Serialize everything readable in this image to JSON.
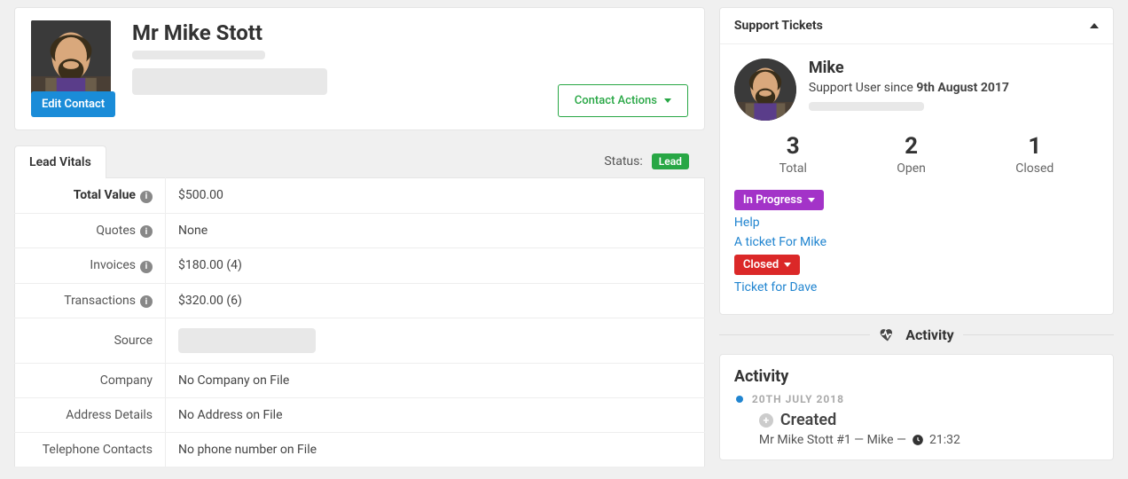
{
  "contact": {
    "name": "Mr Mike Stott",
    "edit_button": "Edit Contact",
    "actions_button": "Contact Actions"
  },
  "vitals": {
    "tab_label": "Lead Vitals",
    "status_label": "Status:",
    "status_badge": "Lead",
    "rows": {
      "total_value": {
        "label": "Total Value",
        "value": "$500.00"
      },
      "quotes": {
        "label": "Quotes",
        "value": "None"
      },
      "invoices": {
        "label": "Invoices",
        "value": "$180.00 (4)"
      },
      "transactions": {
        "label": "Transactions",
        "value": "$320.00 (6)"
      },
      "source": {
        "label": "Source",
        "value": ""
      },
      "company": {
        "label": "Company",
        "value": "No Company on File"
      },
      "address": {
        "label": "Address Details",
        "value": "No Address on File"
      },
      "telephone": {
        "label": "Telephone Contacts",
        "value": "No phone number on File"
      }
    }
  },
  "support": {
    "panel_title": "Support Tickets",
    "user_name": "Mike",
    "since_prefix": "Support User since ",
    "since_date": "9th August 2017",
    "stats": {
      "total": {
        "num": "3",
        "label": "Total"
      },
      "open": {
        "num": "2",
        "label": "Open"
      },
      "closed": {
        "num": "1",
        "label": "Closed"
      }
    },
    "in_progress_label": "In Progress",
    "closed_label": "Closed",
    "tickets_open": [
      "Help",
      "A ticket For Mike"
    ],
    "tickets_closed": [
      "Ticket for Dave"
    ]
  },
  "activity": {
    "divider_label": "Activity",
    "title": "Activity",
    "date": "20TH JULY 2018",
    "event_title": "Created",
    "event_subject": "Mr Mike Stott #1 — Mike —",
    "event_time": "21:32"
  }
}
